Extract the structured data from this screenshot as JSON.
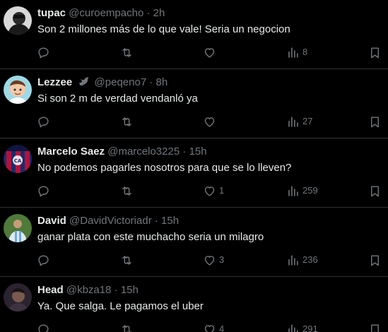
{
  "tweets": [
    {
      "name": "tupac",
      "handle": "@curoempacho",
      "time": "2h",
      "text": "Son 2 millones más de lo que vale! Seria un negocion",
      "replies": "",
      "retweets": "",
      "likes": "",
      "views": "8",
      "badge": null,
      "avatar": "dark-portrait-avatar"
    },
    {
      "name": "Lezzee",
      "handle": "@peqeno7",
      "time": "8h",
      "text": "Si son 2 m de verdad vendanló ya",
      "replies": "",
      "retweets": "",
      "likes": "",
      "views": "27",
      "badge": "bird-icon",
      "avatar": "cartoon-avatar"
    },
    {
      "name": "Marcelo Saez",
      "handle": "@marcelo3225",
      "time": "15h",
      "text": "No podemos pagarles nosotros para que se lo lleven?",
      "replies": "",
      "retweets": "",
      "likes": "1",
      "views": "259",
      "badge": null,
      "avatar": "club-crest-avatar"
    },
    {
      "name": "David",
      "handle": "@DavidVictoriadr",
      "time": "15h",
      "text": "ganar plata con este muchacho seria un milagro",
      "replies": "",
      "retweets": "",
      "likes": "3",
      "views": "236",
      "badge": null,
      "avatar": "football-player-avatar"
    },
    {
      "name": "Head",
      "handle": "@kbza18",
      "time": "15h",
      "text": "Ya. Que salga. Le pagamos el uber",
      "replies": "",
      "retweets": "",
      "likes": "4",
      "views": "291",
      "badge": null,
      "avatar": "person-portrait-avatar"
    }
  ],
  "separator": "·",
  "colors": {
    "background": "#000000",
    "text": "#e7e9ea",
    "muted": "#71767b",
    "divider": "#2f3336"
  }
}
